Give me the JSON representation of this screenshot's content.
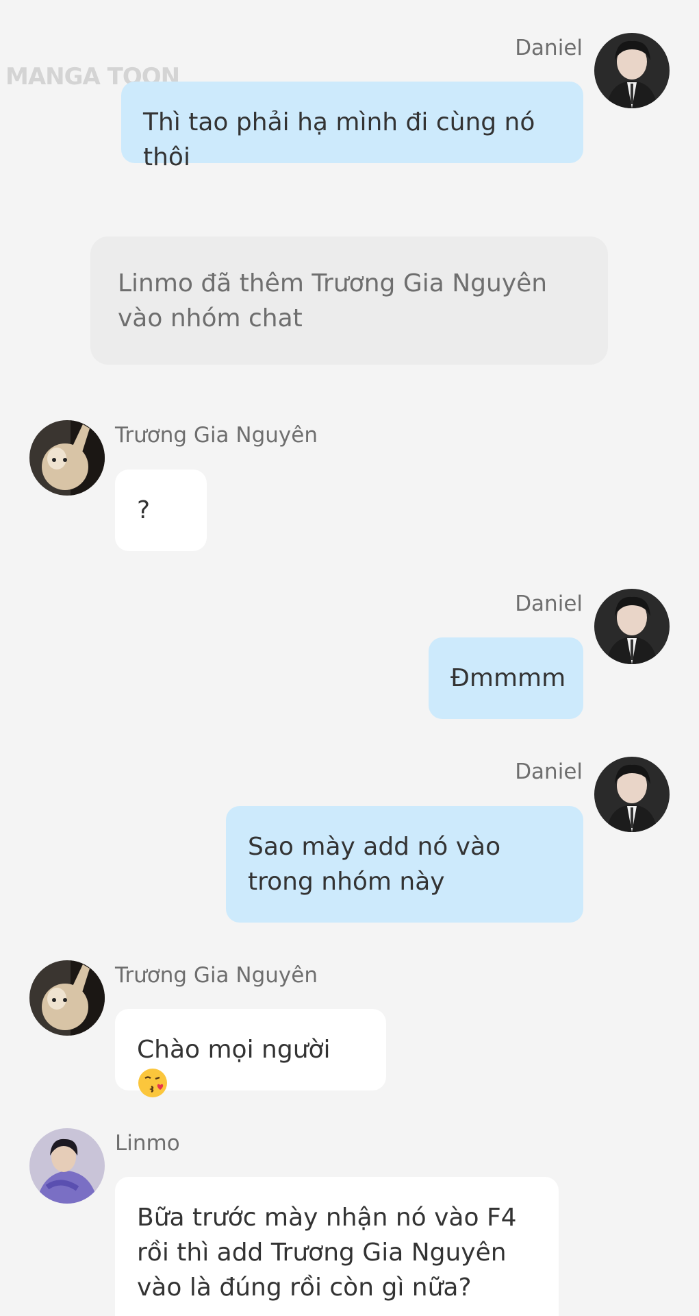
{
  "watermark": "MANGA TOON",
  "system_message": "Linmo đã thêm Trương Gia Nguyên vào nhóm chat",
  "messages": [
    {
      "sender": "Daniel",
      "text": "Thì tao phải hạ mình đi cùng nó thôi"
    },
    {
      "sender": "Trương Gia Nguyên",
      "text": "?"
    },
    {
      "sender": "Daniel",
      "text": "Đmmmm"
    },
    {
      "sender": "Daniel",
      "text": "Sao mày add nó vào trong nhóm này"
    },
    {
      "sender": "Trương Gia Nguyên",
      "text": "Chào mọi người",
      "emoji": "kissing-face-emoji"
    },
    {
      "sender": "Linmo",
      "text": "Bữa trước mày nhận nó vào F4 rồi thì add Trương Gia Nguyên vào là đúng rồi còn gì nữa?"
    }
  ],
  "colors": {
    "background": "#f4f4f4",
    "my_bubble": "#cdeafc",
    "their_bubble": "#ffffff",
    "system_bubble": "#ececec"
  }
}
